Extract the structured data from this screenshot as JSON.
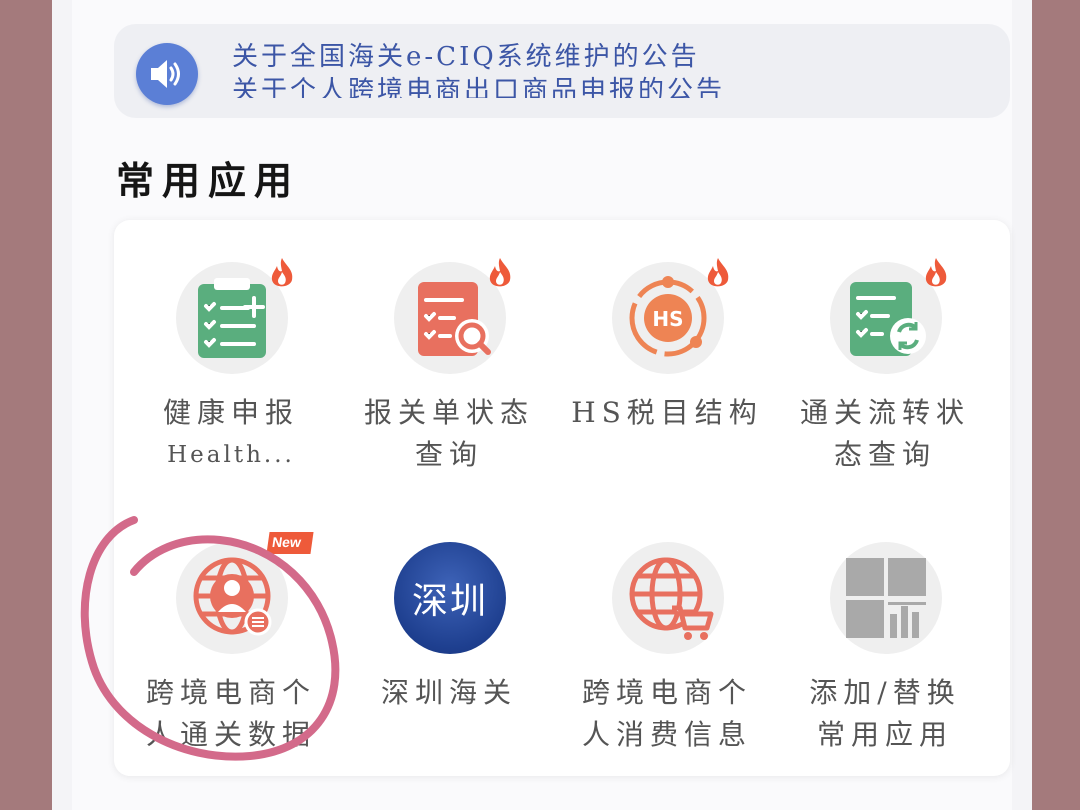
{
  "notice": {
    "icon": "speaker-icon",
    "line1": "关于全国海关e-CIQ系统维护的公告",
    "line2": "关于个人跨境电商出口商品申报的公告"
  },
  "section_title": "常用应用",
  "apps": [
    {
      "name": "health-declaration",
      "title": "健康申报",
      "subtitle": "Health...",
      "icon": "clipboard-add-icon",
      "badge": "hot"
    },
    {
      "name": "declaration-status",
      "title": "报关单状态",
      "title2": "查询",
      "icon": "document-search-icon",
      "badge": "hot"
    },
    {
      "name": "hs-structure",
      "title": "HS税目结构",
      "icon": "hs-orbit-icon",
      "badge": "hot"
    },
    {
      "name": "clearance-status",
      "title": "通关流转状",
      "title2": "态查询",
      "icon": "document-refresh-icon",
      "badge": "hot"
    },
    {
      "name": "cross-border-customs-data",
      "title": "跨境电商个",
      "title2": "人通关数据",
      "icon": "globe-person-icon",
      "badge": "New"
    },
    {
      "name": "shenzhen-customs",
      "title": "深圳海关",
      "icon": "shenzhen-logo-icon",
      "logo_text": "深圳"
    },
    {
      "name": "cross-border-consumption",
      "title": "跨境电商个",
      "title2": "人消费信息",
      "icon": "globe-cart-icon"
    },
    {
      "name": "add-replace",
      "title": "添加/替换",
      "title2": "常用应用",
      "icon": "grid-chart-icon"
    }
  ],
  "colors": {
    "green": "#5aae7e",
    "red": "#e8705f",
    "orange": "#ee8454",
    "blue": "#2a4f9e",
    "gray": "#a9a9a9",
    "annotation": "#d36a8a"
  }
}
